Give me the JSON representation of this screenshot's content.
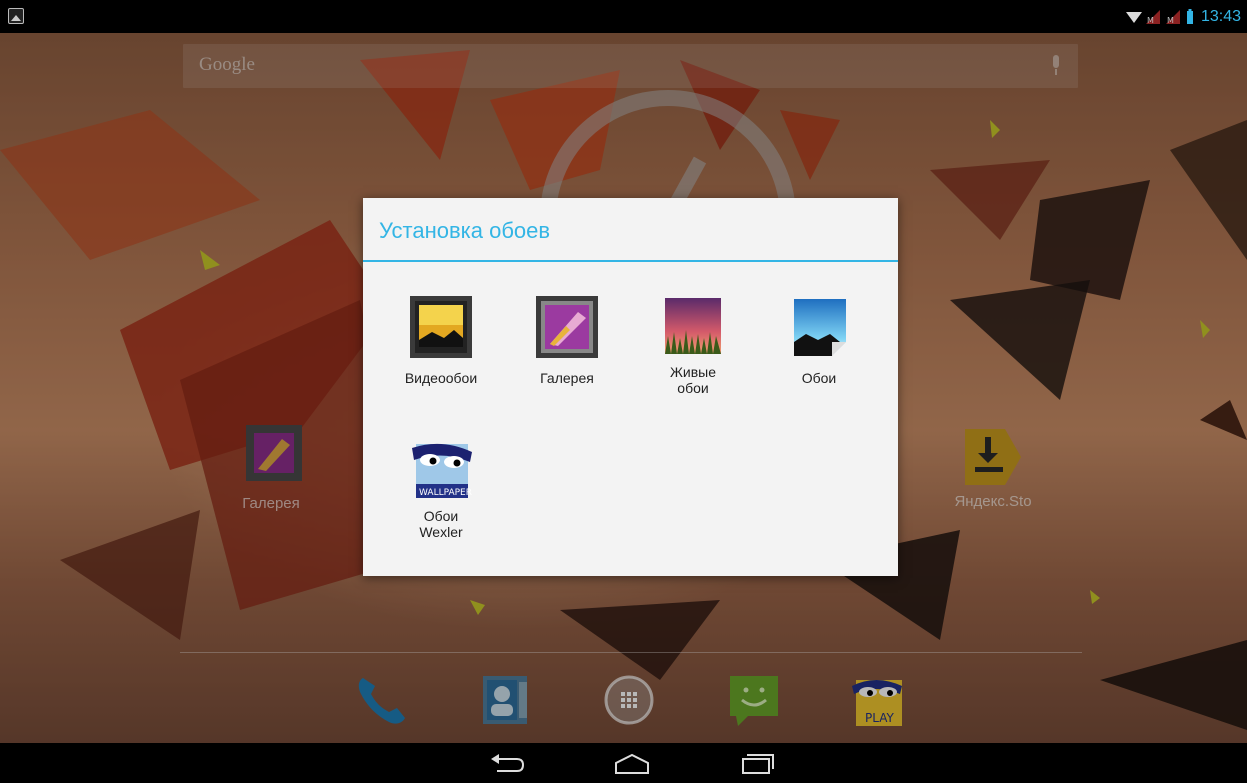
{
  "status_bar": {
    "time": "13:43"
  },
  "search": {
    "placeholder": "Google"
  },
  "desktop": {
    "gallery_label": "Галерея",
    "yandex_label": "Яндекс.Sto"
  },
  "dialog": {
    "title": "Установка обоев",
    "options": [
      {
        "label": "Видеообои",
        "icon": "video-wallpaper-icon"
      },
      {
        "label": "Галерея",
        "icon": "gallery-icon"
      },
      {
        "label": "Живые\nобои",
        "icon": "live-wallpaper-icon"
      },
      {
        "label": "Обои",
        "icon": "wallpaper-icon"
      },
      {
        "label": "Обои\nWexler",
        "icon": "wexler-wallpaper-icon"
      }
    ],
    "wexler_badge": "WALLPAPER"
  },
  "dock": {
    "items": [
      "phone-icon",
      "contacts-icon",
      "app-drawer-icon",
      "messaging-icon",
      "wexler-play-icon"
    ],
    "play_badge": "PLAY"
  },
  "nav": {
    "buttons": [
      "back-button",
      "home-button",
      "recents-button"
    ]
  },
  "colors": {
    "accent": "#33b5e5",
    "dialog_bg": "#f3f3f3"
  }
}
